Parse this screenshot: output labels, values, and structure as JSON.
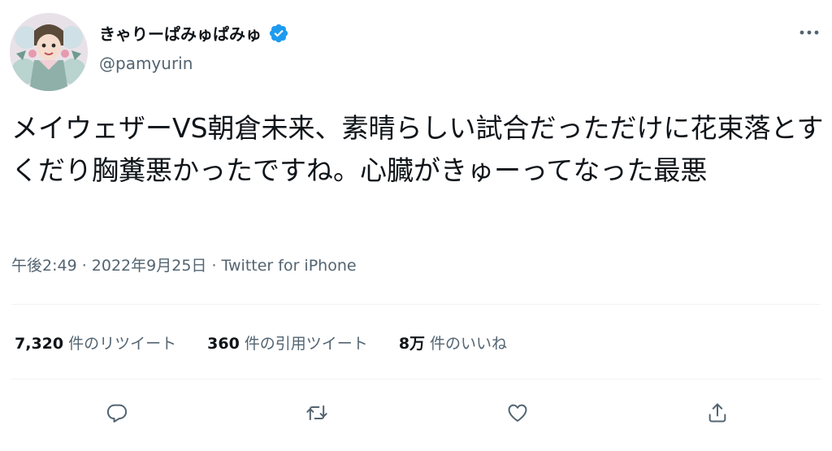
{
  "user": {
    "display_name": "きゃりーぱみゅぱみゅ",
    "handle": "@pamyurin",
    "verified": true
  },
  "tweet": {
    "text": "メイウェザーVS朝倉未来、素晴らしい試合だっただけに花束落とすくだり胸糞悪かったですね。心臓がきゅーってなった最悪",
    "time": "午後2:49",
    "separator1": " · ",
    "date": "2022年9月25日",
    "separator2": " · ",
    "source": "Twitter for iPhone"
  },
  "stats": {
    "retweets": {
      "count": "7,320",
      "label": "件のリツイート"
    },
    "quotes": {
      "count": "360",
      "label": "件の引用ツイート"
    },
    "likes": {
      "count": "8万",
      "label": "件のいいね"
    }
  },
  "icons": {
    "verified": "verified-badge-icon",
    "more": "more-dots-icon",
    "reply": "reply-icon",
    "retweet": "retweet-icon",
    "like": "heart-icon",
    "share": "share-icon"
  },
  "colors": {
    "verified": "#1d9bf0",
    "primary_text": "#0f1419",
    "secondary_text": "#536471",
    "divider": "#eff3f4"
  }
}
